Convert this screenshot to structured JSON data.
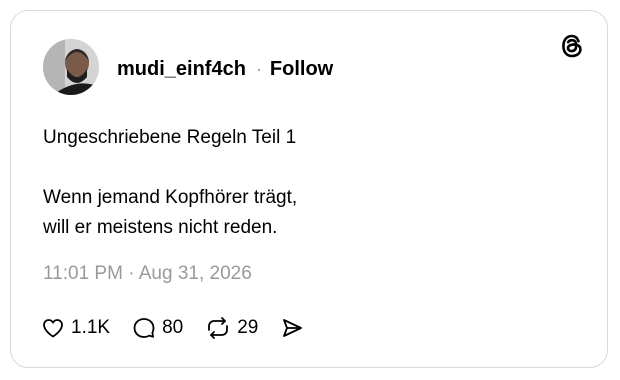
{
  "post": {
    "username": "mudi_einf4ch",
    "separator": "·",
    "follow_label": "Follow",
    "text_line1": "Ungeschriebene Regeln Teil 1",
    "text_line2": "Wenn jemand Kopfhörer trägt,\nwill er meistens nicht reden.",
    "timestamp": "11:01 PM · Aug 31, 2026"
  },
  "actions": {
    "likes": "1.1K",
    "replies": "80",
    "reposts": "29"
  },
  "icons": {
    "brand": "threads-logo-icon",
    "like": "heart-icon",
    "reply": "speech-bubble-icon",
    "repost": "repost-arrows-icon",
    "share": "send-arrow-icon"
  },
  "colors": {
    "text": "#000000",
    "muted": "#9a9a9a",
    "border": "#d9d9d9"
  }
}
